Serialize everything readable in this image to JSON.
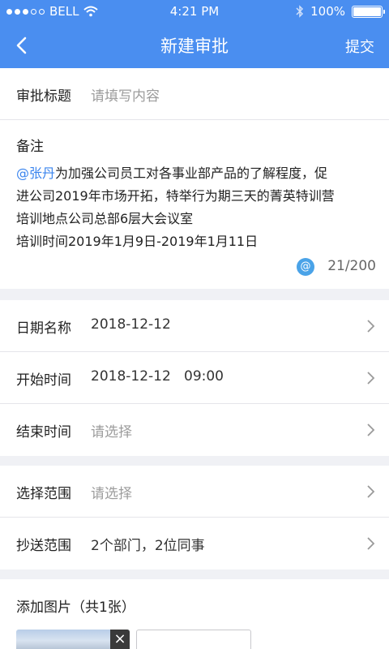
{
  "status_bar": {
    "carrier": "BELL",
    "time": "4:21 PM",
    "battery": "100%"
  },
  "nav": {
    "title": "新建审批",
    "submit": "提交"
  },
  "form": {
    "title_label": "审批标题",
    "title_placeholder": "请填写内容",
    "note_label": "备注",
    "note_mention": "@张丹",
    "note_line1_rest": "为加强公司员工对各事业部产品的了解程度，促",
    "note_line2": "进公司2019年市场开拓，特举行为期三天的菁英特训营",
    "note_line3": "培训地点公司总部6层大会议室",
    "note_line4": "培训时间2019年1月9日-2019年1月11日",
    "counter": "21/200",
    "at_icon_text": "@",
    "date_label": "日期名称",
    "date_value": "2018-12-12",
    "start_label": "开始时间",
    "start_value": "2018-12-12   09:00",
    "end_label": "结束时间",
    "end_placeholder": "请选择",
    "scope_label": "选择范围",
    "scope_placeholder": "请选择",
    "cc_label": "抄送范围",
    "cc_value": "2个部门，2位同事",
    "images_label": "添加图片（共1张）"
  }
}
